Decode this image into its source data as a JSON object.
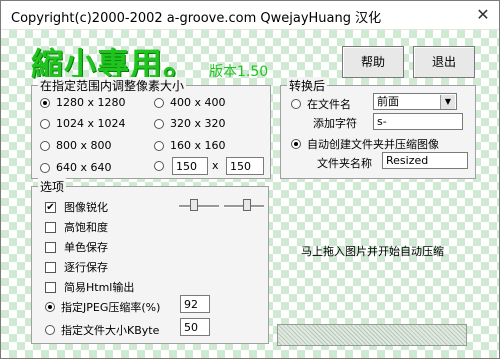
{
  "window": {
    "title": "Copyright(c)2000-2002 a-groove.com QwejayHuang 汉化",
    "close_glyph": "✕"
  },
  "app": {
    "title": "縮小專用。",
    "version": "版本1.50"
  },
  "buttons": {
    "help": "帮助",
    "exit": "退出"
  },
  "size_group": {
    "label": "在指定范围内调整像素大小",
    "options": [
      {
        "label": "1280 x 1280",
        "selected": true
      },
      {
        "label": "400 x 400",
        "selected": false
      },
      {
        "label": "1024 x 1024",
        "selected": false
      },
      {
        "label": "320 x 320",
        "selected": false
      },
      {
        "label": "800 x 800",
        "selected": false
      },
      {
        "label": "160 x 160",
        "selected": false
      },
      {
        "label": "640 x 640",
        "selected": false
      }
    ],
    "custom": {
      "width": "150",
      "x_sep": "x",
      "height": "150"
    }
  },
  "after_convert": {
    "label": "转换后",
    "filename_option": "在文件名",
    "position_select": "前面",
    "add_chars_label": "添加字符",
    "add_chars_value": "s-",
    "auto_folder_option": "自动创建文件夹并压缩图像",
    "folder_name_label": "文件夹名称",
    "folder_name_value": "Resized"
  },
  "options_group": {
    "label": "选项",
    "checkboxes": [
      {
        "label": "图像锐化",
        "checked": true
      },
      {
        "label": "高饱和度",
        "checked": false
      },
      {
        "label": "单色保存",
        "checked": false
      },
      {
        "label": "逐行保存",
        "checked": false
      },
      {
        "label": "简易Html输出",
        "checked": false
      }
    ],
    "jpeg_quality_label": "指定JPEG压缩率(%)",
    "jpeg_quality_value": "92",
    "file_size_label": "指定文件大小KByte",
    "file_size_value": "50",
    "sharpen_level": 0.35,
    "saturation_level": 0.6
  },
  "drop_hint": "马上拖入图片并开始自动压缩"
}
